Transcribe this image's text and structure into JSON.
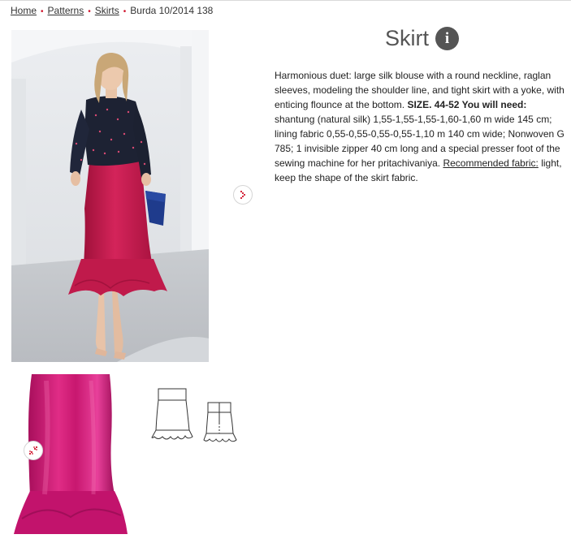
{
  "breadcrumb": {
    "home": "Home",
    "patterns": "Patterns",
    "skirts": "Skirts",
    "current": "Burda 10/2014 138"
  },
  "product": {
    "title": "Skirt",
    "info_icon": "i",
    "description": {
      "intro": "Harmonious duet: large silk blouse with a round neckline, raglan sleeves, modeling the shoulder line, and tight skirt with a yoke, with enticing flounce at the bottom.",
      "size_label": "SIZE. 44-52 You will need:",
      "materials": "shantung (natural silk) 1,55-1,55-1,55-1,60-1,60 m wide 145 cm; lining fabric 0,55-0,55-0,55-0,55-1,10 m 140 cm wide; Nonwoven G 785; 1 invisible zipper 40 cm long and a special presser foot of the sewing machine for her pritachivaniya.",
      "recommended_label": "Recommended fabric:",
      "recommended_text": "light, keep the shape of the skirt fabric."
    }
  },
  "colors": {
    "accent": "#d0142c",
    "skirt": "#c2174e",
    "detail_fabric": "#c4136d",
    "info_bg": "#555555"
  },
  "icons": {
    "next": "chevron-right-icon",
    "zoom": "expand-arrows-icon",
    "info": "info-icon"
  }
}
